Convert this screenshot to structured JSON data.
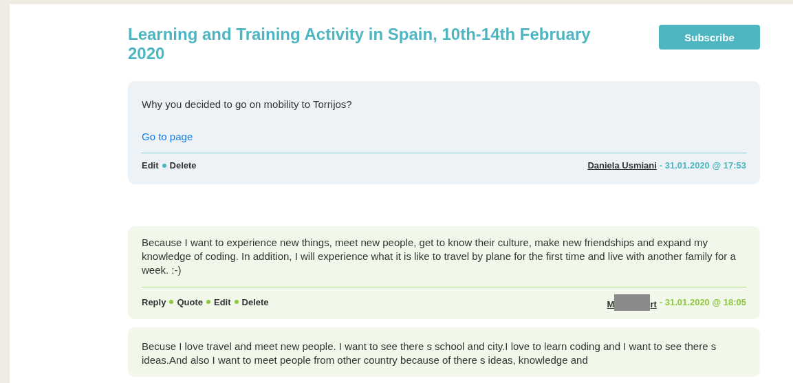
{
  "title": "Learning and Training Activity in Spain, 10th-14th February 2020",
  "subscribe_button": "Subscribe",
  "posts": [
    {
      "kind": "question",
      "text": "Why you decided to go on mobility to Torrijos?",
      "link": "Go to page",
      "actions": [
        "Edit",
        "Delete"
      ],
      "author": "Daniela Usmiani",
      "date": "- 31.01.2020 @ 17:53"
    },
    {
      "kind": "answer",
      "text": "Because I want to experience new things, meet new people, get to know their culture, make new friendships and expand my knowledge of coding. In addition, I will experience what it is like to travel by plane for the first time and live with another family for a week. :-)",
      "actions": [
        "Reply",
        "Quote",
        "Edit",
        "Delete"
      ],
      "author_start": "M",
      "author_end": "rt",
      "redacted": true,
      "date": "- 31.01.2020 @ 18:05"
    },
    {
      "kind": "answer",
      "text": "Becuse I love travel and meet new people. I want to see there s school and city.I love to learn coding and I want to see there s ideas.And also I want to meet people from other country because of there s ideas, knowledge and"
    }
  ]
}
